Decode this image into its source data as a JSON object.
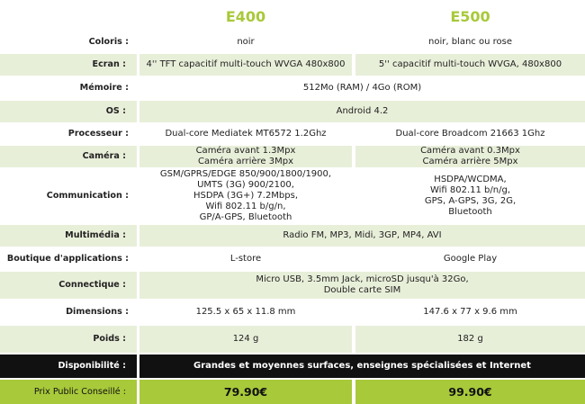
{
  "headers": {
    "model1": "E400",
    "model2": "E500"
  },
  "rows": {
    "coloris": {
      "label": "Coloris :",
      "v1": "noir",
      "v2": "noir, blanc ou rose"
    },
    "ecran": {
      "label": "Ecran :",
      "v1": "4'' TFT capacitif multi-touch WVGA 480x800",
      "v2": "5'' capacitif multi-touch WVGA, 480x800"
    },
    "memoire": {
      "label": "Mémoire :",
      "v": "512Mo (RAM) / 4Go (ROM)"
    },
    "os": {
      "label": "OS :",
      "v": "Android 4.2"
    },
    "processeur": {
      "label": "Processeur :",
      "v1": "Dual-core Mediatek MT6572 1.2Ghz",
      "v2": "Dual-core Broadcom 21663 1Ghz"
    },
    "camera": {
      "label": "Caméra :",
      "v1": "Caméra avant 1.3Mpx\nCaméra arrière 3Mpx",
      "v2": "Caméra avant 0.3Mpx\nCaméra arrière 5Mpx"
    },
    "communication": {
      "label": "Communication :",
      "v1": "GSM/GPRS/EDGE 850/900/1800/1900,\nUMTS (3G) 900/2100,\nHSDPA (3G+) 7.2Mbps,\nWifi 802.11 b/g/n,\nGP/A-GPS, Bluetooth",
      "v2": "HSDPA/WCDMA,\nWifi 802.11 b/n/g,\nGPS, A-GPS, 3G, 2G,\nBluetooth"
    },
    "multimedia": {
      "label": "Multimédia :",
      "v": "Radio FM, MP3, Midi, 3GP, MP4, AVI"
    },
    "boutique": {
      "label": "Boutique d'applications :",
      "v1": "L-store",
      "v2": "Google Play"
    },
    "connectique": {
      "label": "Connectique :",
      "v": "Micro USB, 3.5mm Jack, microSD jusqu'à 32Go,\nDouble carte SIM"
    },
    "dimensions": {
      "label": "Dimensions :",
      "v1": "125.5 x 65 x 11.8 mm",
      "v2": "147.6 x 77 x 9.6 mm"
    },
    "poids": {
      "label": "Poids :",
      "v1": "124 g",
      "v2": "182 g"
    },
    "disponibilite": {
      "label": "Disponibilité :",
      "v": "Grandes et moyennes surfaces, enseignes spécialisées et Internet"
    },
    "prix": {
      "label": "Prix Public Conseillé :",
      "v1": "79.90€",
      "v2": "99.90€"
    }
  },
  "colors": {
    "accent_green": "#a8c93a",
    "row_tint": "#e8efd9",
    "dark_band": "#111111"
  }
}
